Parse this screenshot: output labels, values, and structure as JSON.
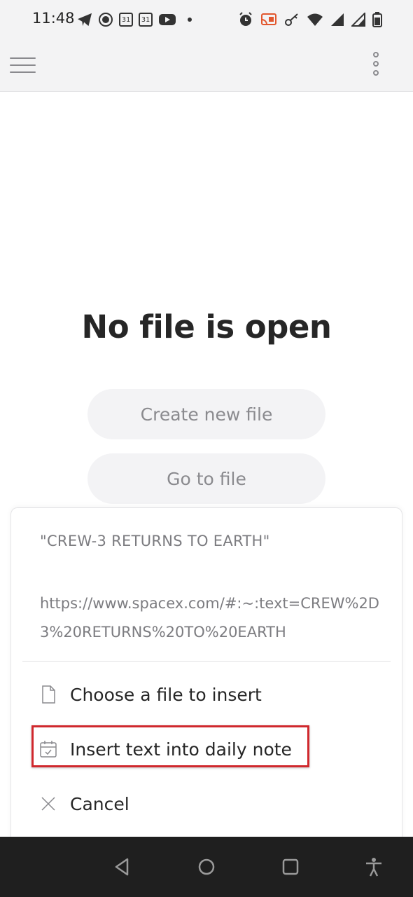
{
  "status_bar": {
    "time": "11:48",
    "calendar_day_1": "31",
    "calendar_day_2": "31",
    "icons_left": [
      "telegram-icon",
      "record-icon",
      "calendar-icon",
      "calendar-icon",
      "youtube-icon",
      "dot-icon"
    ],
    "icons_right": [
      "alarm-icon",
      "cast-icon",
      "key-icon",
      "wifi-icon",
      "signal-icon",
      "signal-icon",
      "battery-icon"
    ]
  },
  "app_bar": {
    "menu_icon": "hamburger-icon",
    "more_icon": "more-vertical-icon"
  },
  "main": {
    "title": "No file is open",
    "create_label": "Create new file",
    "goto_label": "Go to file"
  },
  "sheet": {
    "quote_text": "\"CREW-3 RETURNS TO EARTH\"",
    "url_text": "https://www.spacex.com/#:~:text=CREW%2D3%20RETURNS%20TO%20EARTH",
    "items": [
      {
        "label": "Choose a file to insert",
        "icon": "file-icon"
      },
      {
        "label": "Insert text into daily note",
        "icon": "calendar-check-icon"
      },
      {
        "label": "Cancel",
        "icon": "close-icon"
      }
    ],
    "highlight_color": "#d0282d"
  },
  "nav_bar": {
    "buttons": [
      "back-icon",
      "home-icon",
      "recents-icon",
      "accessibility-icon"
    ]
  }
}
